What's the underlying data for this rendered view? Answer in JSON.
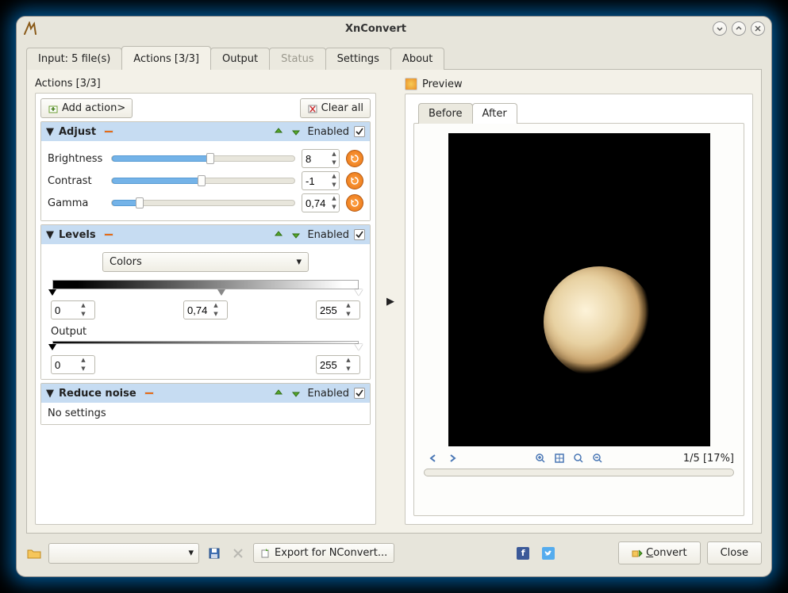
{
  "window": {
    "title": "XnConvert",
    "buttons": {
      "min": "⌄",
      "max": "⌃",
      "close": "✕"
    }
  },
  "tabs": [
    {
      "label": "Input: 5 file(s)",
      "active": false,
      "disabled": false
    },
    {
      "label": "Actions [3/3]",
      "active": true,
      "disabled": false
    },
    {
      "label": "Output",
      "active": false,
      "disabled": false
    },
    {
      "label": "Status",
      "active": false,
      "disabled": true
    },
    {
      "label": "Settings",
      "active": false,
      "disabled": false
    },
    {
      "label": "About",
      "active": false,
      "disabled": false
    }
  ],
  "actionsPanel": {
    "title": "Actions [3/3]",
    "addAction": "Add action>",
    "clearAll": "Clear all"
  },
  "adjust": {
    "title": "Adjust",
    "enabledLabel": "Enabled",
    "enabled": true,
    "brightness": {
      "label": "Brightness",
      "value": "8",
      "percent": 54
    },
    "contrast": {
      "label": "Contrast",
      "value": "-1",
      "percent": 49
    },
    "gamma": {
      "label": "Gamma",
      "value": "0,74",
      "percent": 15
    }
  },
  "levels": {
    "title": "Levels",
    "enabledLabel": "Enabled",
    "enabled": true,
    "channel": "Colors",
    "input": {
      "low": "0",
      "mid": "0,74",
      "high": "255",
      "midPercent": 55
    },
    "outputLabel": "Output",
    "output": {
      "low": "0",
      "high": "255"
    }
  },
  "reduceNoise": {
    "title": "Reduce noise",
    "enabledLabel": "Enabled",
    "enabled": true,
    "body": "No settings"
  },
  "preview": {
    "title": "Preview",
    "tabs": {
      "before": "Before",
      "after": "After",
      "active": "after"
    },
    "status": "1/5 [17%]"
  },
  "bottom": {
    "export": "Export for NConvert...",
    "convert": "Convert",
    "convert_accel": "C",
    "close": "Close"
  }
}
